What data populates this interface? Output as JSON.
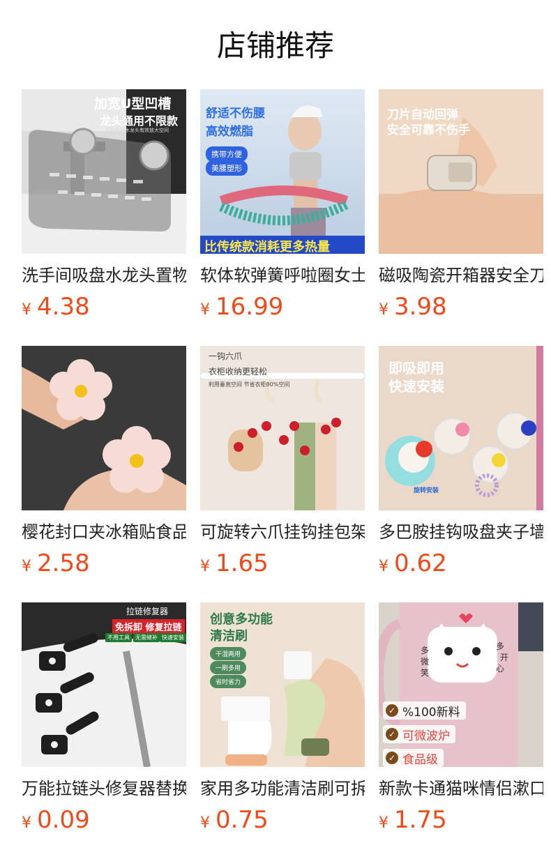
{
  "page": {
    "title": "店铺推荐"
  },
  "currency": "¥",
  "products": [
    {
      "name": "洗手间吸盘水龙头置物架",
      "price": "4.38",
      "image": {
        "icon": "faucet-shelf-image",
        "headline": "加宽U型凹槽",
        "subline": "龙头通用不限款",
        "note": "巧妙避开水龙头有效放大空间"
      }
    },
    {
      "name": "软体软弹簧呼啦圈女士",
      "price": "16.99",
      "image": {
        "icon": "hula-hoop-image",
        "headline": "舒适不伤腰",
        "subline": "高效燃脂",
        "chips": [
          "携带方便",
          "美腰塑形"
        ],
        "banner": "比传统款消耗更多热量"
      }
    },
    {
      "name": "磁吸陶瓷开箱器安全刀",
      "price": "3.98",
      "image": {
        "icon": "box-cutter-image",
        "headline": "刀片自动回弹",
        "subline": "安全可靠不伤手"
      }
    },
    {
      "name": "樱花封口夹冰箱贴食品",
      "price": "2.58",
      "image": {
        "icon": "sakura-clip-image"
      }
    },
    {
      "name": "可旋转六爪挂钩挂包架",
      "price": "1.65",
      "image": {
        "icon": "rotating-hook-image",
        "headline": "一钩六爪",
        "subline": "衣柜收纳更轻松",
        "note": "利用垂直空间 节省衣柜80%空间"
      }
    },
    {
      "name": "多巴胺挂钩吸盘夹子墙",
      "price": "0.62",
      "image": {
        "icon": "suction-hook-image",
        "headline": "即吸即用",
        "subline": "快速安装",
        "note": "旋转安装"
      }
    },
    {
      "name": "万能拉链头修复器替换",
      "price": "0.09",
      "image": {
        "icon": "zipper-repair-image",
        "headline": "拉链修复器",
        "subline": "免拆卸 修复拉链",
        "chips": [
          "不用工具",
          "无需缝补",
          "快速安装"
        ]
      }
    },
    {
      "name": "家用多功能清洁刷可拆",
      "price": "0.75",
      "image": {
        "icon": "cleaning-brush-image",
        "headline": "创意多功能",
        "subline": "清洁刷",
        "chips": [
          "干湿两用",
          "一刷多用",
          "省时省力"
        ]
      }
    },
    {
      "name": "新款卡通猫咪情侣漱口杯",
      "price": "1.75",
      "image": {
        "icon": "cat-mug-image",
        "mug_text": [
          "多",
          "微",
          "笑",
          "多",
          "开",
          "心"
        ],
        "badges": [
          "%100新料",
          "可微波炉",
          "食品级"
        ]
      }
    }
  ]
}
